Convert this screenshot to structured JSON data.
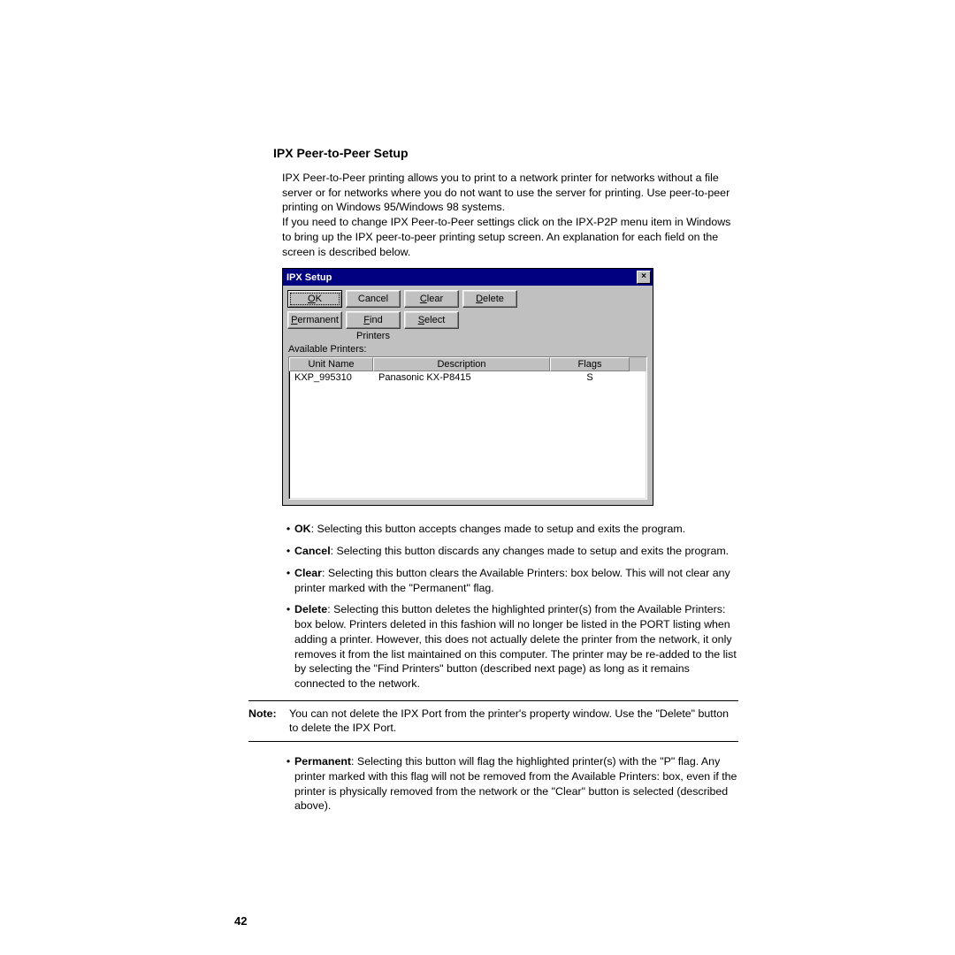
{
  "section": {
    "title": "IPX Peer-to-Peer Setup",
    "para1": "IPX Peer-to-Peer printing allows you to print to a network printer for networks without a file server or for networks where you do not want to use the server for printing. Use peer-to-peer printing on Windows 95/Windows 98 systems.",
    "para2": "If you need to change IPX Peer-to-Peer settings click on the IPX-P2P menu item in Windows to bring up the IPX peer-to-peer printing setup screen. An explanation for each field on the screen is described below."
  },
  "dialog": {
    "title": "IPX Setup",
    "close": "×",
    "buttons": {
      "ok": "OK",
      "cancel": "Cancel",
      "clear": "Clear",
      "delete": "Delete",
      "permanent": "Permanent",
      "find_printers": "Find Printers",
      "select": "Select"
    },
    "available_label": "Available Printers:",
    "columns": {
      "unit": "Unit Name",
      "desc": "Description",
      "flags": "Flags"
    },
    "row": {
      "unit": "KXP_995310",
      "desc": "Panasonic KX-P8415",
      "flags": "S"
    }
  },
  "bullets": {
    "ok_label": "OK",
    "ok_text": ": Selecting this button accepts changes made to setup and exits the program.",
    "cancel_label": "Cancel",
    "cancel_text": ": Selecting this button discards any changes made to setup and exits the program.",
    "clear_label": "Clear",
    "clear_text": ": Selecting this button clears the Available Printers: box below. This will not clear any printer marked with the \"Permanent\" flag.",
    "delete_label": "Delete",
    "delete_text": ": Selecting this button deletes the highlighted printer(s) from the Available Printers: box below. Printers deleted in this fashion will no longer be listed in the PORT listing when adding a printer. However, this does not actually delete the printer from the network, it only removes it from the list maintained on this computer. The printer may be re-added to the list by selecting the \"Find Printers\" button (described next page) as long as it remains connected to the network.",
    "permanent_label": "Permanent",
    "permanent_text": ": Selecting this button will flag the highlighted printer(s) with the \"P\" flag. Any printer marked with this flag will not be removed from the Available Printers: box, even if the printer is physically removed from the network or the \"Clear\" button is selected (described above)."
  },
  "note": {
    "label": "Note:",
    "text": "You can not delete the IPX Port from the printer's property window. Use the \"Delete\" button to delete the IPX Port."
  },
  "page_number": "42"
}
